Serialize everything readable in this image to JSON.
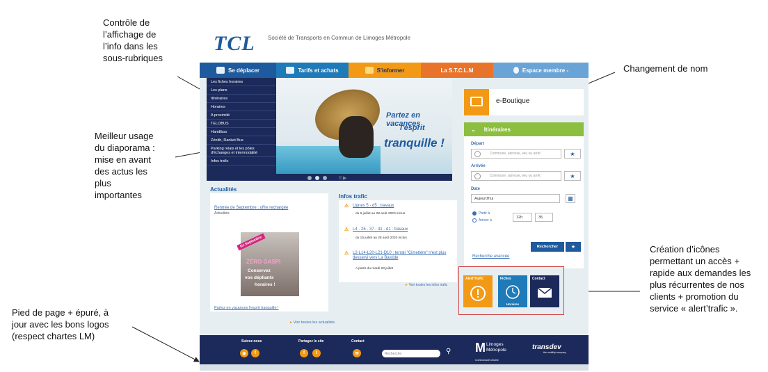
{
  "annotations": {
    "controle": [
      "Contrôle de",
      "l’affichage de",
      "l’info dans les",
      "sous-rubriques"
    ],
    "changement": [
      "Changement de nom"
    ],
    "diaporama": [
      "Meilleur usage",
      "du diaporama :",
      "mise en avant",
      "des actus les",
      "plus",
      "importantes"
    ],
    "icones": [
      "Création d’icônes",
      "permettant un accès +",
      "rapide aux demandes les",
      "plus récurrentes de nos",
      "clients + promotion du",
      "service « alert’trafic »."
    ],
    "pied": [
      "Pied de page + épuré, à",
      "jour avec les bons logos",
      "(respect chartes LM)"
    ]
  },
  "site": {
    "logo": "TCL",
    "tagline": "Société de Transports en Commun de Limoges Métropole",
    "nav": [
      {
        "label": "Se déplacer",
        "color": "#1e5a9e"
      },
      {
        "label": "Tarifs et achats",
        "color": "#1e7ab8"
      },
      {
        "label": "S'informer",
        "color": "#f29a16"
      },
      {
        "label": "La S.T.C.L.M",
        "color": "#e8742b"
      },
      {
        "label": "Espace membre -",
        "color": "#6aa3d6"
      }
    ],
    "dropdown": [
      "Les fiches horaires",
      "Les plans",
      "Itinéraires",
      "Horaires",
      "A proximité",
      "TELOBUS",
      "Handibus",
      "Zénith, Ranket Bus",
      "Parking relais et les pôles d'échanges et intermodalité",
      "Infos trafic"
    ],
    "hero": {
      "line1": "Partez en vacances",
      "line2": "l'esprit",
      "line3": "tranquille !",
      "pause": "II ▶"
    },
    "eboutique": "e-Boutique",
    "itineraires": {
      "title": "Itinéraires",
      "depart_label": "Départ",
      "depart_placeholder": "Commune, adresse, lieu ou arrêt",
      "arrivee_label": "Arrivée",
      "arrivee_placeholder": "Commune, adresse, lieu ou arrêt",
      "date_label": "Date",
      "date_value": "Aujourd'hui",
      "partir": "Partir à",
      "arriver": "Arriver à",
      "hour": "12h",
      "minute": "35",
      "search": "Rechercher",
      "advanced": "Recherche avancée"
    },
    "quick": {
      "alert": "Alert'Trafic",
      "fiches": "Fiches",
      "fiches_sub": "Horaires",
      "contact": "Contact"
    },
    "actualites": {
      "title": "Actualités",
      "link": "Rentrée de Septembre : offre rechargée",
      "sub": "Actualités",
      "banner": "En Septembre",
      "img_title": "ZÉRO GASPI",
      "img_l1": "Conservez",
      "img_l2": "vos dépliants",
      "img_l3": "horaires !",
      "foot_link": "Partez en vacances l'esprit tranquille !",
      "all": "Voir toutes les actualités"
    },
    "trafic": {
      "title": "Infos trafic",
      "items": [
        {
          "link": "Lignes 5 - d5 : travaux",
          "sub": "du 6 juillet au 28 août 2020 inclus"
        },
        {
          "link": "L4 - 25 - 37 - 41 - d1 : travaux",
          "sub": "du 15 juillet au 28 août 2020 inclus"
        },
        {
          "link": "L2-L14-L20-L21-D10 : terrati \"Cimetière\" n'est plus desservi vers La Bastide",
          "sub": "A partir du mardi 28 juillet"
        }
      ],
      "more": "Voir toutes les infos trafic"
    },
    "footer": {
      "suivez": "Suivez-nous",
      "partagez": "Partagez le site",
      "contact": "Contact",
      "search_placeholder": "Recherche",
      "lm_line1": "Limoges",
      "lm_line2": "Métropole",
      "lm_sub": "Communauté urbaine",
      "transdev": "transdev",
      "transdev_sub": "the mobility company"
    },
    "colors": {
      "navy": "#1b2a5a",
      "blue": "#1e5a9e",
      "orange": "#f29a16",
      "green": "#8cbe3f"
    }
  }
}
